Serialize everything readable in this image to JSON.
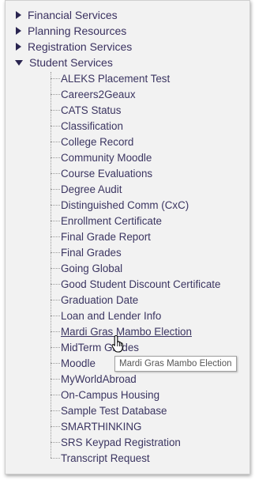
{
  "categories": [
    {
      "label": "Financial Services",
      "expanded": false
    },
    {
      "label": "Planning Resources",
      "expanded": false
    },
    {
      "label": "Registration Services",
      "expanded": false
    },
    {
      "label": "Student Services",
      "expanded": true
    }
  ],
  "student_services_items": [
    {
      "label": "ALEKS Placement Test"
    },
    {
      "label": "Careers2Geaux"
    },
    {
      "label": "CATS Status"
    },
    {
      "label": "Classification"
    },
    {
      "label": "College Record"
    },
    {
      "label": "Community Moodle"
    },
    {
      "label": "Course Evaluations"
    },
    {
      "label": "Degree Audit"
    },
    {
      "label": "Distinguished Comm (CxC)"
    },
    {
      "label": "Enrollment Certificate"
    },
    {
      "label": "Final Grade Report"
    },
    {
      "label": "Final Grades"
    },
    {
      "label": "Going Global"
    },
    {
      "label": "Good Student Discount Certificate"
    },
    {
      "label": "Graduation Date"
    },
    {
      "label": "Loan and Lender Info"
    },
    {
      "label": "Mardi Gras Mambo Election",
      "hovered": true
    },
    {
      "label": "MidTerm Grades"
    },
    {
      "label": "Moodle"
    },
    {
      "label": "MyWorldAbroad"
    },
    {
      "label": "On-Campus Housing"
    },
    {
      "label": "Sample Test Database"
    },
    {
      "label": "SMARTHINKING"
    },
    {
      "label": "SRS Keypad Registration"
    },
    {
      "label": "Transcript Request"
    }
  ],
  "tooltip": {
    "text": "Mardi Gras Mambo Election"
  },
  "cursor": {
    "icon": "hand-pointer-icon"
  },
  "colors": {
    "link_text": "#3b3561",
    "triangle": "#2a2550",
    "panel_bg": "#f2f2f2"
  }
}
